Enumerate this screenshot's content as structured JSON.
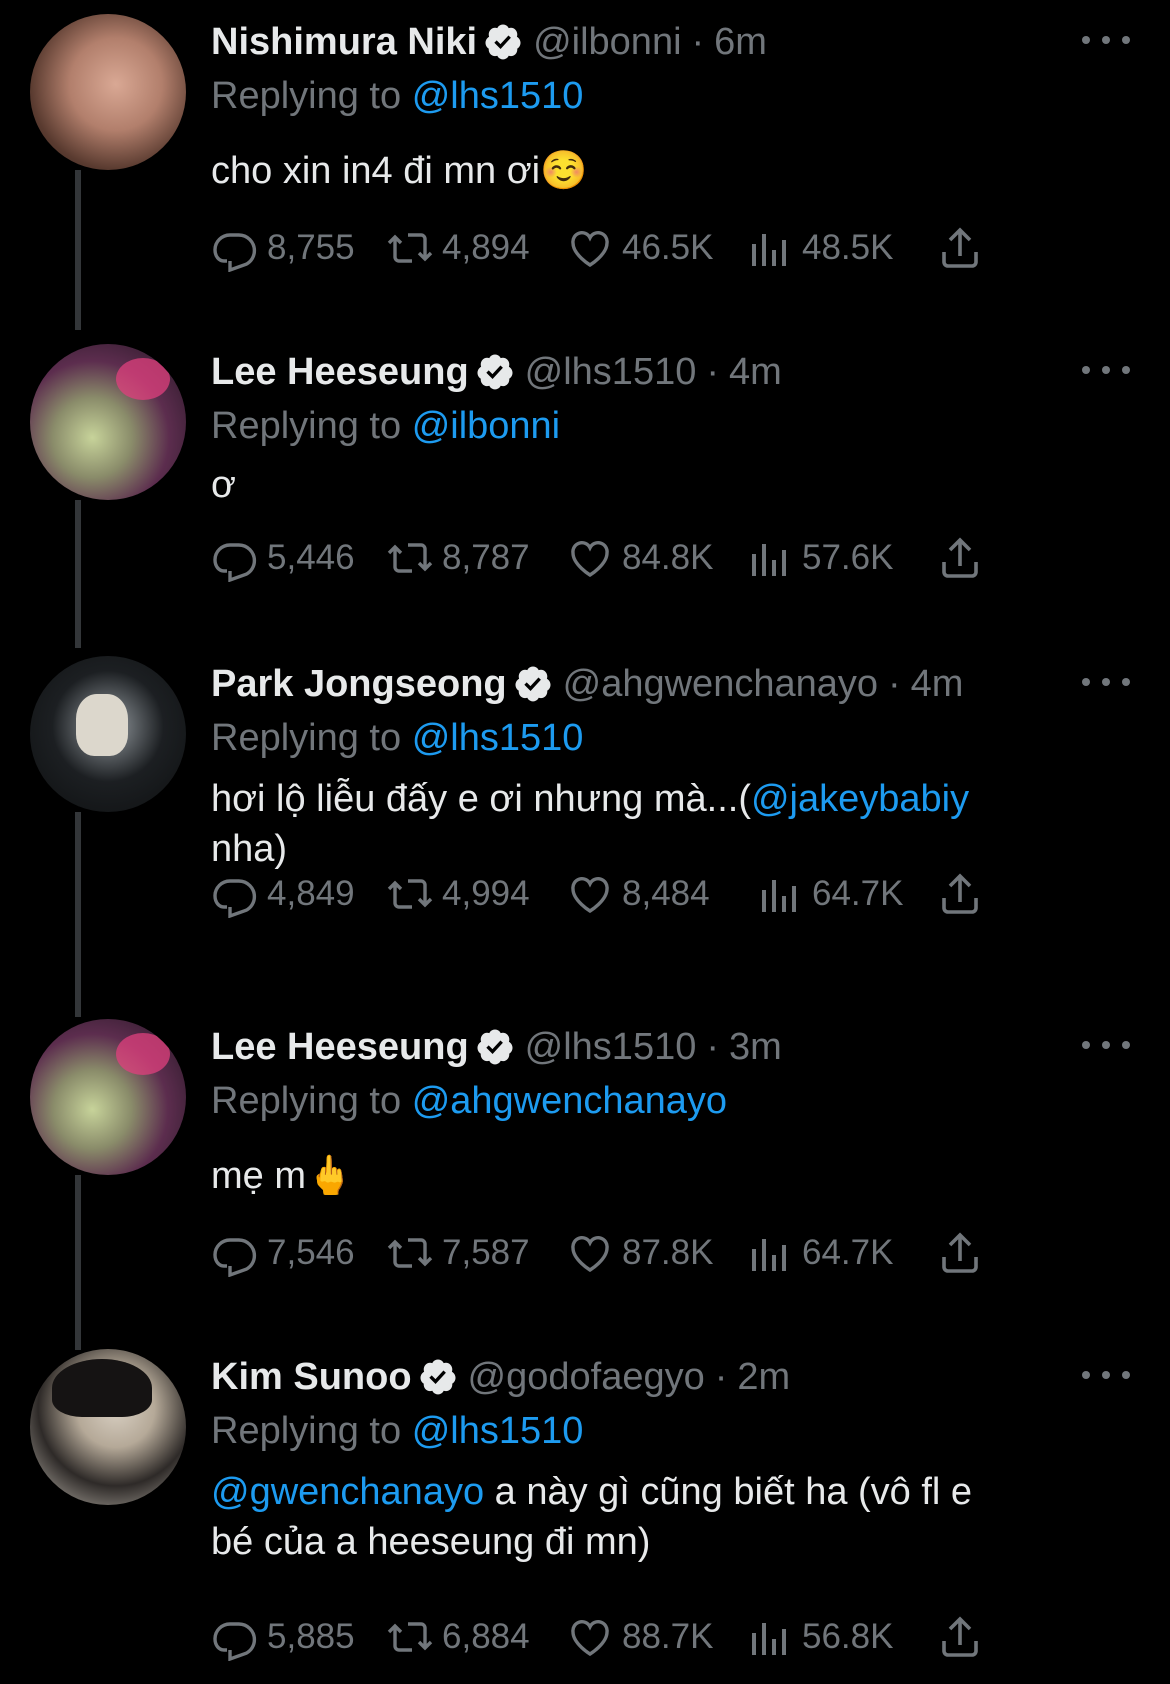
{
  "tweets": [
    {
      "name": "Nishimura Niki",
      "handle": "@ilbonni",
      "time": "6m",
      "replying_label": "Replying to",
      "replying_to": "@lhs1510",
      "text": "cho xin in4 đi mn ơi☺️",
      "mention": "",
      "after_mention": "",
      "replies": "8,755",
      "retweets": "4,894",
      "likes": "46.5K",
      "views": "48.5K"
    },
    {
      "name": "Lee Heeseung",
      "handle": "@lhs1510",
      "time": "4m",
      "replying_label": "Replying to",
      "replying_to": "@ilbonni",
      "text": "ơ",
      "mention": "",
      "after_mention": "",
      "replies": "5,446",
      "retweets": "8,787",
      "likes": "84.8K",
      "views": "57.6K"
    },
    {
      "name": "Park Jongseong",
      "handle": "@ahgwenchanayo",
      "time": "4m",
      "replying_label": "Replying to",
      "replying_to": "@lhs1510",
      "text": "hơi lộ liễu đấy e ơi nhưng mà...(",
      "mention": "@jakeybabiy",
      "after_mention": "\nnha)",
      "replies": "4,849",
      "retweets": "4,994",
      "likes": "8,484",
      "views": "64.7K"
    },
    {
      "name": "Lee Heeseung",
      "handle": "@lhs1510",
      "time": "3m",
      "replying_label": "Replying to",
      "replying_to": "@ahgwenchanayo",
      "text": "mẹ m🖕",
      "mention": "",
      "after_mention": "",
      "replies": "7,546",
      "retweets": "7,587",
      "likes": "87.8K",
      "views": "64.7K"
    },
    {
      "name": "Kim Sunoo",
      "handle": "@godofaegyo",
      "time": "2m",
      "replying_label": "Replying to",
      "replying_to": "@lhs1510",
      "text": "",
      "mention": "@gwenchanayo",
      "after_mention": " a này gì cũng biết ha (vô fl e\nbé của a heeseung đi mn)",
      "replies": "5,885",
      "retweets": "6,884",
      "likes": "88.7K",
      "views": "56.8K"
    }
  ],
  "icons": {
    "reply": "reply-icon",
    "retweet": "retweet-icon",
    "like": "like-icon",
    "views": "views-icon",
    "share": "share-icon",
    "verified": "verified-badge-icon",
    "more": "more-options-icon"
  },
  "colors": {
    "background": "#000000",
    "text": "#e7e9ea",
    "muted": "#71767b",
    "link": "#1d9bf0",
    "thread_line": "#333639"
  }
}
